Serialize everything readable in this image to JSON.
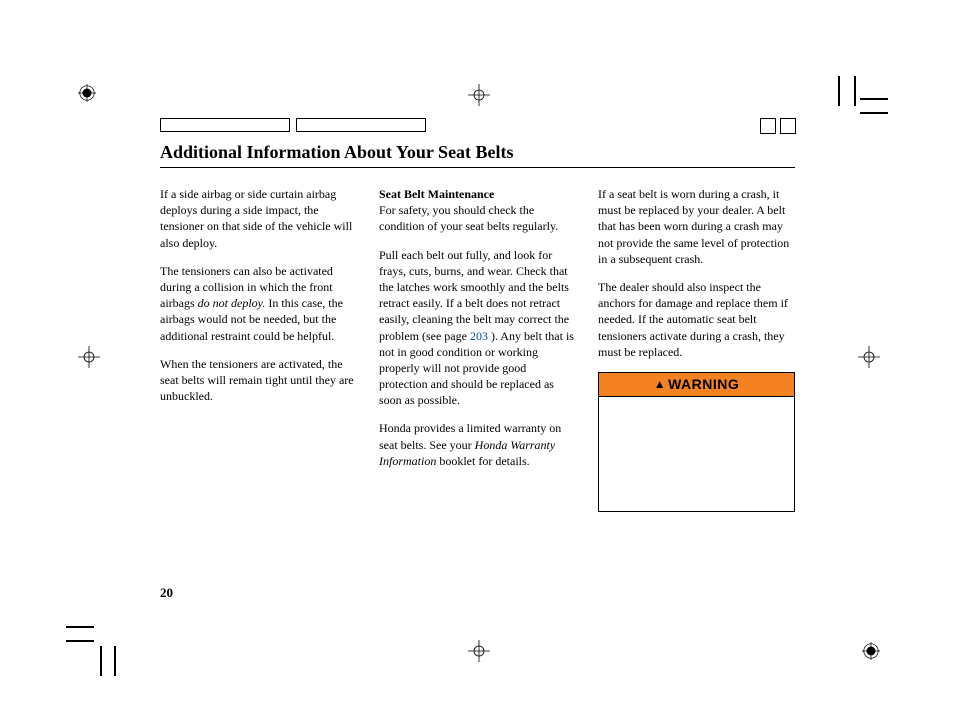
{
  "title": "Additional Information About Your Seat Belts",
  "page_number": "20",
  "col1": {
    "p1": "If a side airbag or side curtain airbag deploys during a side impact, the tensioner on that side of the vehicle will also deploy.",
    "p2a": "The tensioners can also be activated during a collision in which the front airbags ",
    "p2_em": "do not deploy.",
    "p2b": " In this case, the airbags would not be needed, but the additional restraint could be helpful.",
    "p3": "When the tensioners are activated, the seat belts will remain tight until they are unbuckled."
  },
  "col2": {
    "subhead": "Seat Belt Maintenance",
    "p1": "For safety, you should check the condition of your seat belts regularly.",
    "p2a": "Pull each belt out fully, and look for frays, cuts, burns, and wear. Check that the latches work smoothly and the belts retract easily. If a belt does not retract easily, cleaning the belt may correct the problem (see page ",
    "p2_link": "203",
    "p2b": " ). Any belt that is not in good condition or working properly will not provide good protection and should be replaced as soon as possible.",
    "p3a": "Honda provides a limited warranty on seat belts. See your ",
    "p3_em": "Honda Warranty Information",
    "p3b": " booklet for details."
  },
  "col3": {
    "p1": "If a seat belt is worn during a crash, it must be replaced by your dealer. A belt that has been worn during a crash may not provide the same level of protection in a subsequent crash.",
    "p2": "The dealer should also inspect the anchors for damage and replace them if needed. If the automatic seat belt tensioners activate during a crash, they must be replaced.",
    "warning_label": "WARNING"
  }
}
